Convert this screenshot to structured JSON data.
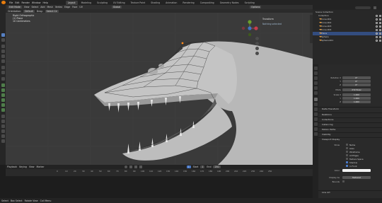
{
  "top_menu": [
    "File",
    "Edit",
    "Render",
    "Window",
    "Help"
  ],
  "workspaces": [
    "Layout",
    "Modeling",
    "Sculpting",
    "UV Editing",
    "Texture Paint",
    "Shading",
    "Animation",
    "Rendering",
    "Compositing",
    "Geometry Nodes",
    "Scripting"
  ],
  "viewport": {
    "header": {
      "mode": "Edit Mode",
      "menus": [
        "View",
        "Select",
        "Add",
        "Mesh",
        "Vertex",
        "Edge",
        "Face",
        "UV"
      ],
      "transform": "Global",
      "options": "Options"
    },
    "header2": {
      "orientation": "Orientation:",
      "orientation_value": "Default",
      "drag": "Drag:",
      "drag_value": "Select Cir"
    },
    "overlay_lines": [
      "Right Orthographic",
      "(1) Plane",
      "10 Centimeters"
    ],
    "transform_panel": "Transform",
    "nothing_selected": "Nothing selected"
  },
  "timeline": {
    "menus": [
      "Playback",
      "Keying",
      "View",
      "Marker"
    ],
    "start_label": "Start",
    "start": "1",
    "end_label": "End",
    "end": "250",
    "current_frame": "1",
    "ruler": [
      "0",
      "10",
      "20",
      "30",
      "40",
      "50",
      "60",
      "70",
      "80",
      "90",
      "100",
      "110",
      "120",
      "130",
      "140",
      "150",
      "160",
      "170",
      "180",
      "190",
      "200",
      "210",
      "220",
      "230",
      "240",
      "250"
    ]
  },
  "statusbar": [
    "Select",
    "Box Select",
    "Rotate View",
    "Call Menu"
  ],
  "outliner": {
    "rows": [
      {
        "label": "Scene Collection",
        "selected": false
      },
      {
        "label": "Collection",
        "selected": false
      },
      {
        "label": "Cone.001",
        "selected": false
      },
      {
        "label": "Cone.002",
        "selected": false
      },
      {
        "label": "Cone.003",
        "selected": false
      },
      {
        "label": "Cone.004",
        "selected": false
      },
      {
        "label": "Plane",
        "selected": true
      },
      {
        "label": "Sphere",
        "selected": false
      },
      {
        "label": "Sphere.001",
        "selected": false
      }
    ]
  },
  "properties": {
    "rotation": {
      "label": "Rotation X",
      "y": "Y",
      "z": "Z",
      "x_val": "0°",
      "y_val": "0°",
      "z_val": "0°"
    },
    "mode": {
      "label": "Mode",
      "value": "XYZ Euler"
    },
    "scale": {
      "label": "Scale X",
      "y": "Y",
      "z": "Z",
      "x_val": "1.000",
      "y_val": "1.000",
      "z_val": "1.000"
    },
    "sections": [
      "Delta Transform",
      "Relations",
      "Collections",
      "Instancing",
      "Motion Paths",
      "Visibility",
      "Viewport Display"
    ],
    "show_label": "Show",
    "checks": [
      {
        "label": "Name",
        "on": false
      },
      {
        "label": "Axes",
        "on": false
      },
      {
        "label": "Wireframe",
        "on": false
      },
      {
        "label": "All Edges",
        "on": false
      },
      {
        "label": "Texture Space",
        "on": false
      },
      {
        "label": "Shadow",
        "on": true
      },
      {
        "label": "In Front",
        "on": true
      }
    ],
    "color_label": "Color",
    "display_as_label": "Display As",
    "display_as_value": "Textured",
    "bounds_label": "Bounds",
    "line_art": "Line Art"
  }
}
